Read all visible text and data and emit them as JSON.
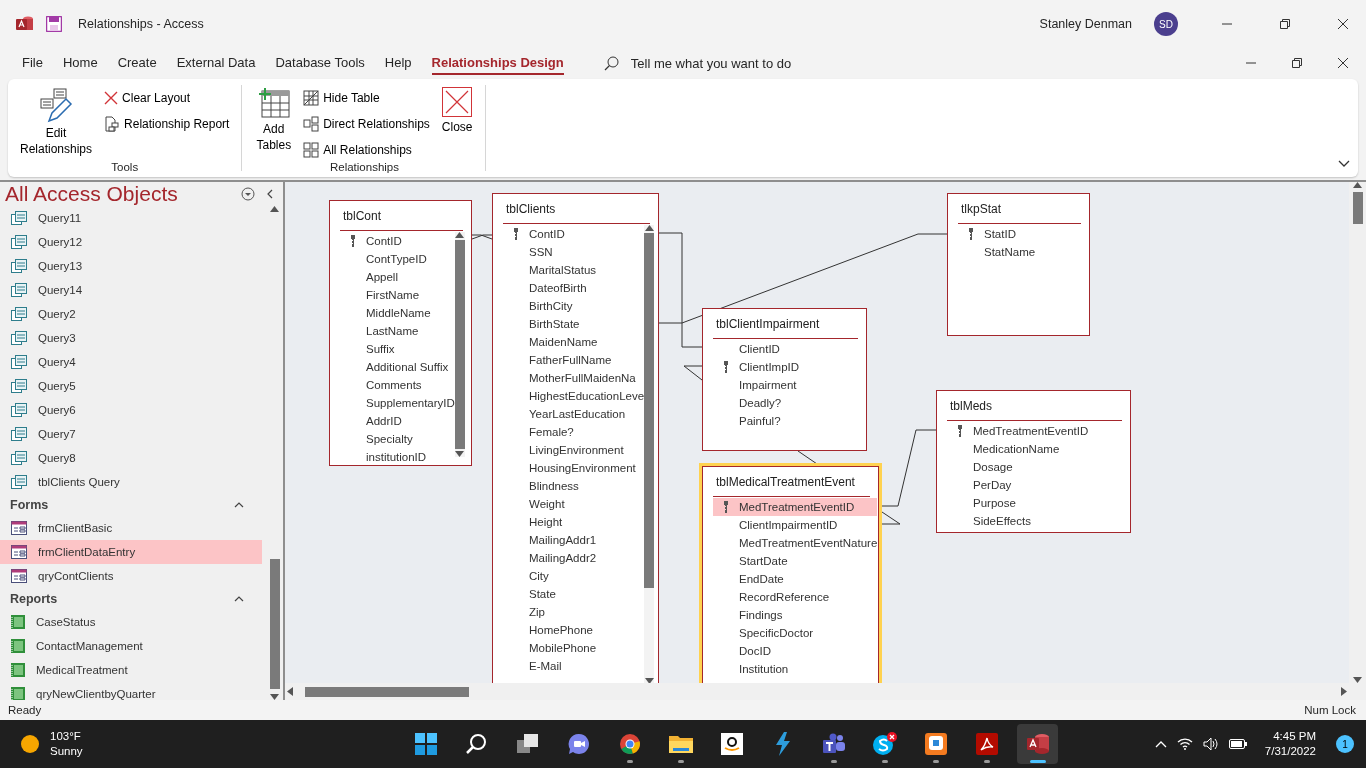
{
  "title_bar": {
    "title": "Relationships  -  Access",
    "user_name": "Stanley Denman",
    "user_initials": "SD"
  },
  "ribbon_tabs": [
    {
      "label": "File",
      "selected": false
    },
    {
      "label": "Home",
      "selected": false
    },
    {
      "label": "Create",
      "selected": false
    },
    {
      "label": "External Data",
      "selected": false
    },
    {
      "label": "Database Tools",
      "selected": false
    },
    {
      "label": "Help",
      "selected": false
    },
    {
      "label": "Relationships Design",
      "selected": true
    }
  ],
  "tell_me": "Tell me what you want to do",
  "ribbon_groups": [
    {
      "label": "Tools",
      "commands": [
        {
          "label": "Edit Relationships",
          "kind": "large"
        },
        {
          "label": "Clear Layout",
          "kind": "small"
        },
        {
          "label": "Relationship Report",
          "kind": "small"
        }
      ]
    },
    {
      "label": "Relationships",
      "commands": [
        {
          "label": "Add Tables",
          "kind": "large"
        },
        {
          "label": "Hide Table",
          "kind": "small"
        },
        {
          "label": "Direct Relationships",
          "kind": "small"
        },
        {
          "label": "All Relationships",
          "kind": "small"
        },
        {
          "label": "Close",
          "kind": "large"
        }
      ]
    }
  ],
  "nav": {
    "title": "All Access Objects",
    "groups": [
      {
        "kind": "query",
        "items": [
          {
            "label": "Query11",
            "selected": false
          },
          {
            "label": "Query12",
            "selected": false
          },
          {
            "label": "Query13",
            "selected": false
          },
          {
            "label": "Query14",
            "selected": false
          },
          {
            "label": "Query2",
            "selected": false
          },
          {
            "label": "Query3",
            "selected": false
          },
          {
            "label": "Query4",
            "selected": false
          },
          {
            "label": "Query5",
            "selected": false
          },
          {
            "label": "Query6",
            "selected": false
          },
          {
            "label": "Query7",
            "selected": false
          },
          {
            "label": "Query8",
            "selected": false
          },
          {
            "label": "tblClients Query",
            "selected": false
          }
        ]
      },
      {
        "kind": "form",
        "label": "Forms",
        "expanded": true,
        "items": [
          {
            "label": "frmClientBasic",
            "selected": false
          },
          {
            "label": "frmClientDataEntry",
            "selected": true
          },
          {
            "label": "qryContClients",
            "selected": false
          }
        ]
      },
      {
        "kind": "report",
        "label": "Reports",
        "expanded": true,
        "items": [
          {
            "label": "CaseStatus",
            "selected": false
          },
          {
            "label": "ContactManagement",
            "selected": false
          },
          {
            "label": "MedicalTreatment",
            "selected": false
          },
          {
            "label": "qryNewClientbyQuarter",
            "selected": false
          }
        ]
      }
    ]
  },
  "tables": [
    {
      "name": "tblCont",
      "selected": false,
      "fields": [
        {
          "name": "ContID",
          "primary_key": true,
          "selected": false
        },
        {
          "name": "ContTypeID",
          "primary_key": false,
          "selected": false
        },
        {
          "name": "Appell",
          "primary_key": false,
          "selected": false
        },
        {
          "name": "FirstName",
          "primary_key": false,
          "selected": false
        },
        {
          "name": "MiddleName",
          "primary_key": false,
          "selected": false
        },
        {
          "name": "LastName",
          "primary_key": false,
          "selected": false
        },
        {
          "name": "Suffix",
          "primary_key": false,
          "selected": false
        },
        {
          "name": "Additional Suffix",
          "primary_key": false,
          "selected": false
        },
        {
          "name": "Comments",
          "primary_key": false,
          "selected": false
        },
        {
          "name": "SupplementaryID",
          "primary_key": false,
          "selected": false
        },
        {
          "name": "AddrID",
          "primary_key": false,
          "selected": false
        },
        {
          "name": "Specialty",
          "primary_key": false,
          "selected": false
        },
        {
          "name": "institutionID",
          "primary_key": false,
          "selected": false
        }
      ]
    },
    {
      "name": "tblClients",
      "selected": false,
      "fields": [
        {
          "name": "ContID",
          "primary_key": true,
          "selected": false
        },
        {
          "name": "SSN",
          "primary_key": false,
          "selected": false
        },
        {
          "name": "MaritalStatus",
          "primary_key": false,
          "selected": false
        },
        {
          "name": "DateofBirth",
          "primary_key": false,
          "selected": false
        },
        {
          "name": "BirthCity",
          "primary_key": false,
          "selected": false
        },
        {
          "name": "BirthState",
          "primary_key": false,
          "selected": false
        },
        {
          "name": "MaidenName",
          "primary_key": false,
          "selected": false
        },
        {
          "name": "FatherFullName",
          "primary_key": false,
          "selected": false
        },
        {
          "name": "MotherFullMaidenNa",
          "primary_key": false,
          "selected": false
        },
        {
          "name": "HighestEducationLeve",
          "primary_key": false,
          "selected": false
        },
        {
          "name": "YearLastEducation",
          "primary_key": false,
          "selected": false
        },
        {
          "name": "Female?",
          "primary_key": false,
          "selected": false
        },
        {
          "name": "LivingEnvironment",
          "primary_key": false,
          "selected": false
        },
        {
          "name": "HousingEnvironment",
          "primary_key": false,
          "selected": false
        },
        {
          "name": "Blindness",
          "primary_key": false,
          "selected": false
        },
        {
          "name": "Weight",
          "primary_key": false,
          "selected": false
        },
        {
          "name": "Height",
          "primary_key": false,
          "selected": false
        },
        {
          "name": "MailingAddr1",
          "primary_key": false,
          "selected": false
        },
        {
          "name": "MailingAddr2",
          "primary_key": false,
          "selected": false
        },
        {
          "name": "City",
          "primary_key": false,
          "selected": false
        },
        {
          "name": "State",
          "primary_key": false,
          "selected": false
        },
        {
          "name": "Zip",
          "primary_key": false,
          "selected": false
        },
        {
          "name": "HomePhone",
          "primary_key": false,
          "selected": false
        },
        {
          "name": "MobilePhone",
          "primary_key": false,
          "selected": false
        },
        {
          "name": "E-Mail",
          "primary_key": false,
          "selected": false
        }
      ]
    },
    {
      "name": "tlkpStat",
      "selected": false,
      "fields": [
        {
          "name": "StatID",
          "primary_key": true,
          "selected": false
        },
        {
          "name": "StatName",
          "primary_key": false,
          "selected": false
        }
      ]
    },
    {
      "name": "tblClientImpairment",
      "selected": false,
      "fields": [
        {
          "name": "ClientID",
          "primary_key": false,
          "selected": false
        },
        {
          "name": "ClientImpID",
          "primary_key": true,
          "selected": false
        },
        {
          "name": "Impairment",
          "primary_key": false,
          "selected": false
        },
        {
          "name": "Deadly?",
          "primary_key": false,
          "selected": false
        },
        {
          "name": "Painful?",
          "primary_key": false,
          "selected": false
        }
      ]
    },
    {
      "name": "tblMeds",
      "selected": false,
      "fields": [
        {
          "name": "MedTreatmentEventID",
          "primary_key": true,
          "selected": false
        },
        {
          "name": "MedicationName",
          "primary_key": false,
          "selected": false
        },
        {
          "name": "Dosage",
          "primary_key": false,
          "selected": false
        },
        {
          "name": "PerDay",
          "primary_key": false,
          "selected": false
        },
        {
          "name": "Purpose",
          "primary_key": false,
          "selected": false
        },
        {
          "name": "SideEffects",
          "primary_key": false,
          "selected": false
        }
      ]
    },
    {
      "name": "tblMedicalTreatmentEvent",
      "selected": true,
      "fields": [
        {
          "name": "MedTreatmentEventID",
          "primary_key": true,
          "selected": true
        },
        {
          "name": "ClientImpairmentID",
          "primary_key": false,
          "selected": false
        },
        {
          "name": "MedTreatmentEventNature",
          "primary_key": false,
          "selected": false
        },
        {
          "name": "StartDate",
          "primary_key": false,
          "selected": false
        },
        {
          "name": "EndDate",
          "primary_key": false,
          "selected": false
        },
        {
          "name": "RecordReference",
          "primary_key": false,
          "selected": false
        },
        {
          "name": "Findings",
          "primary_key": false,
          "selected": false
        },
        {
          "name": "SpecificDoctor",
          "primary_key": false,
          "selected": false
        },
        {
          "name": "DocID",
          "primary_key": false,
          "selected": false
        },
        {
          "name": "Institution",
          "primary_key": false,
          "selected": false
        }
      ]
    }
  ],
  "status_bar": {
    "left": "Ready",
    "right": "Num Lock"
  },
  "taskbar": {
    "weather": {
      "temperature": "103°F",
      "condition": "Sunny"
    },
    "apps": [
      {
        "kind": "start",
        "running": false,
        "selected": false
      },
      {
        "kind": "search",
        "running": false,
        "selected": false
      },
      {
        "kind": "taskview",
        "running": false,
        "selected": false
      },
      {
        "kind": "chat",
        "running": false,
        "selected": false
      },
      {
        "kind": "chrome",
        "running": true,
        "selected": false
      },
      {
        "kind": "explorer",
        "running": true,
        "selected": false
      },
      {
        "kind": "amazon",
        "running": false,
        "selected": false
      },
      {
        "kind": "bolt",
        "running": false,
        "selected": false
      },
      {
        "kind": "teams",
        "running": true,
        "selected": false
      },
      {
        "kind": "skype",
        "running": true,
        "selected": false
      },
      {
        "kind": "remote",
        "running": true,
        "selected": false
      },
      {
        "kind": "acrobat",
        "running": true,
        "selected": false
      },
      {
        "kind": "access",
        "running": true,
        "selected": true
      }
    ],
    "time": "4:45 PM",
    "date": "7/31/2022",
    "notifications": "1"
  }
}
